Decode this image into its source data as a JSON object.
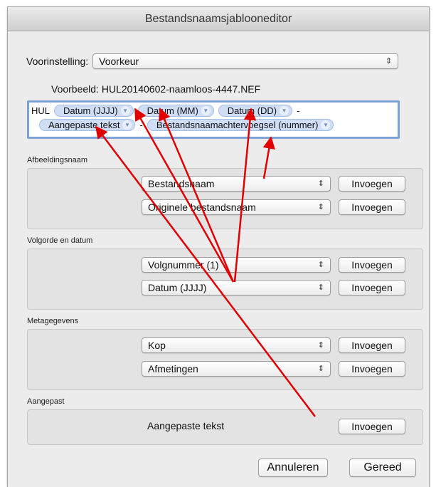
{
  "window": {
    "title": "Bestandsnaamsjablooneditor"
  },
  "preset": {
    "label": "Voorinstelling:",
    "value": "Voorkeur"
  },
  "example": {
    "label": "Voorbeeld:",
    "value": "HUL20140602-naamloos-4447.NEF"
  },
  "template": {
    "prefix": "HUL",
    "line1_tokens": [
      "Datum (JJJJ)",
      "Datum (MM)",
      "Datum (DD)"
    ],
    "line1_suffix": "-",
    "line2_token1": "Aangepaste tekst",
    "line2_sep": "-",
    "line2_token2": "Bestandsnaamachtervoegsel (nummer)"
  },
  "sections": {
    "image_name": {
      "title": "Afbeeldingsnaam",
      "field1": "Bestandsnaam",
      "field2": "Originele bestandsnaam"
    },
    "sequence_date": {
      "title": "Volgorde en datum",
      "field1": "Volgnummer (1)",
      "field2": "Datum (JJJJ)"
    },
    "metadata": {
      "title": "Metagegevens",
      "field1": "Kop",
      "field2": "Afmetingen"
    },
    "custom": {
      "title": "Aangepast",
      "text": "Aangepaste tekst"
    }
  },
  "insert_label": "Invoegen",
  "footer": {
    "cancel": "Annuleren",
    "done": "Gereed"
  },
  "icons": {
    "popup_arrows": "⇕",
    "token_arrow": "▼"
  },
  "colors": {
    "token_bg": "#cfdef5",
    "focus_ring": "#7ea4d7",
    "annotation_arrows": "#e00000"
  }
}
